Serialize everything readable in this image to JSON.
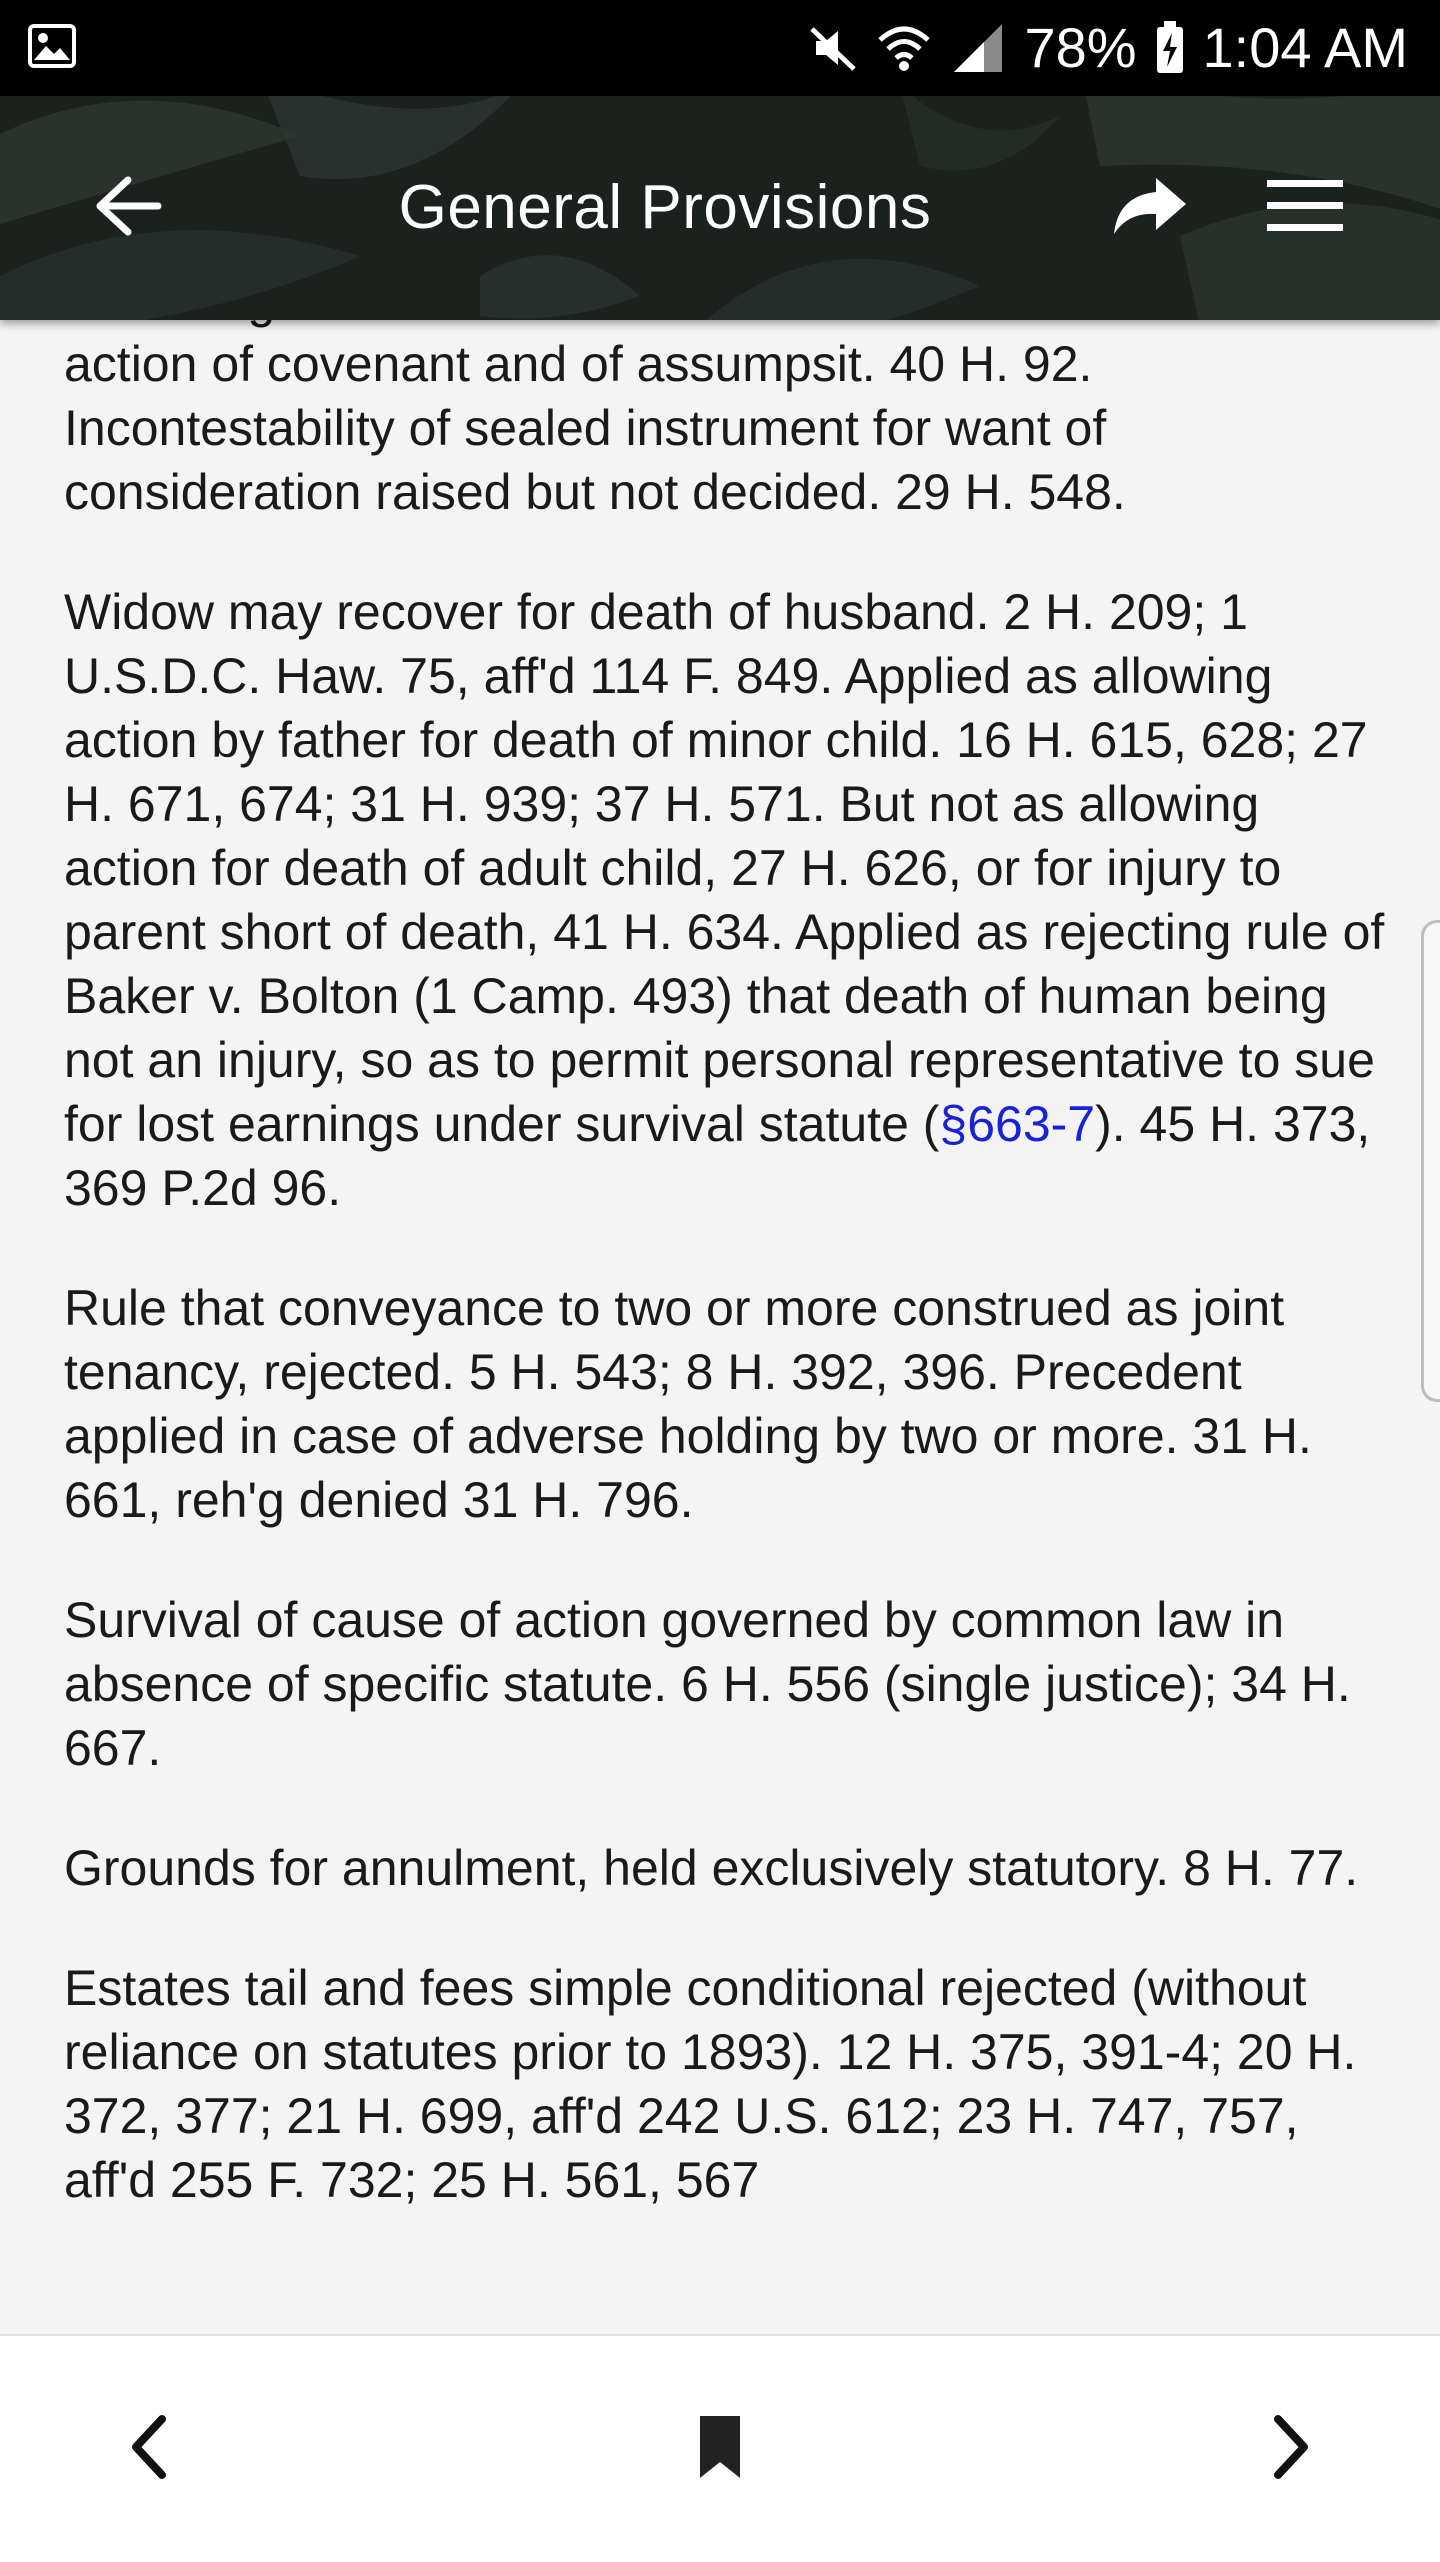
{
  "status_bar": {
    "battery": "78%",
    "time": "1:04 AM",
    "icons": [
      "image-icon",
      "mute-icon",
      "wifi-icon",
      "signal-icon",
      "battery-charging-icon"
    ]
  },
  "app_bar": {
    "title": "General Provisions",
    "back_icon": "arrow-left-icon",
    "share_icon": "share-icon",
    "menu_icon": "hamburger-menu-icon"
  },
  "content": {
    "paragraphs": [
      "rendering of no force common law distinction between action of covenant and of assumpsit. 40 H. 92. Incontestability of sealed instrument for want of consideration raised but not decided. 29 H. 548.",
      {
        "before": "Widow may recover for death of husband. 2 H. 209; 1 U.S.D.C. Haw. 75, aff'd 114 F. 849. Applied as allowing action by father for death of minor child. 16 H. 615, 628; 27 H. 671, 674; 31 H. 939; 37 H. 571. But not as allowing action for death of adult child, 27 H. 626, or for injury to parent short of death, 41 H. 634. Applied as rejecting rule of Baker v. Bolton (1 Camp. 493) that death of human being not an injury, so as to permit personal representative to sue for lost earnings under survival statute (",
        "link": "§663-7",
        "after": "). 45 H. 373, 369 P.2d 96."
      },
      "Rule that conveyance to two or more construed as joint tenancy, rejected. 5 H. 543; 8 H. 392, 396. Precedent applied in case of adverse holding by two or more. 31 H. 661, reh'g denied 31 H. 796.",
      "Survival of cause of action governed by common law in absence of specific statute. 6 H. 556 (single justice); 34 H. 667.",
      "Grounds for annulment, held exclusively statutory. 8 H. 77.",
      "Estates tail and fees simple conditional rejected (without reliance on statutes prior to 1893). 12 H. 375, 391-4; 20 H. 372, 377; 21 H. 699, aff'd 242 U.S. 612; 23 H. 747, 757, aff'd 255 F. 732; 25 H. 561, 567"
    ],
    "link_color": "#1a22d8"
  },
  "bottom_nav": {
    "prev_icon": "chevron-left-icon",
    "bookmark_icon": "bookmark-icon",
    "next_icon": "chevron-right-icon"
  }
}
